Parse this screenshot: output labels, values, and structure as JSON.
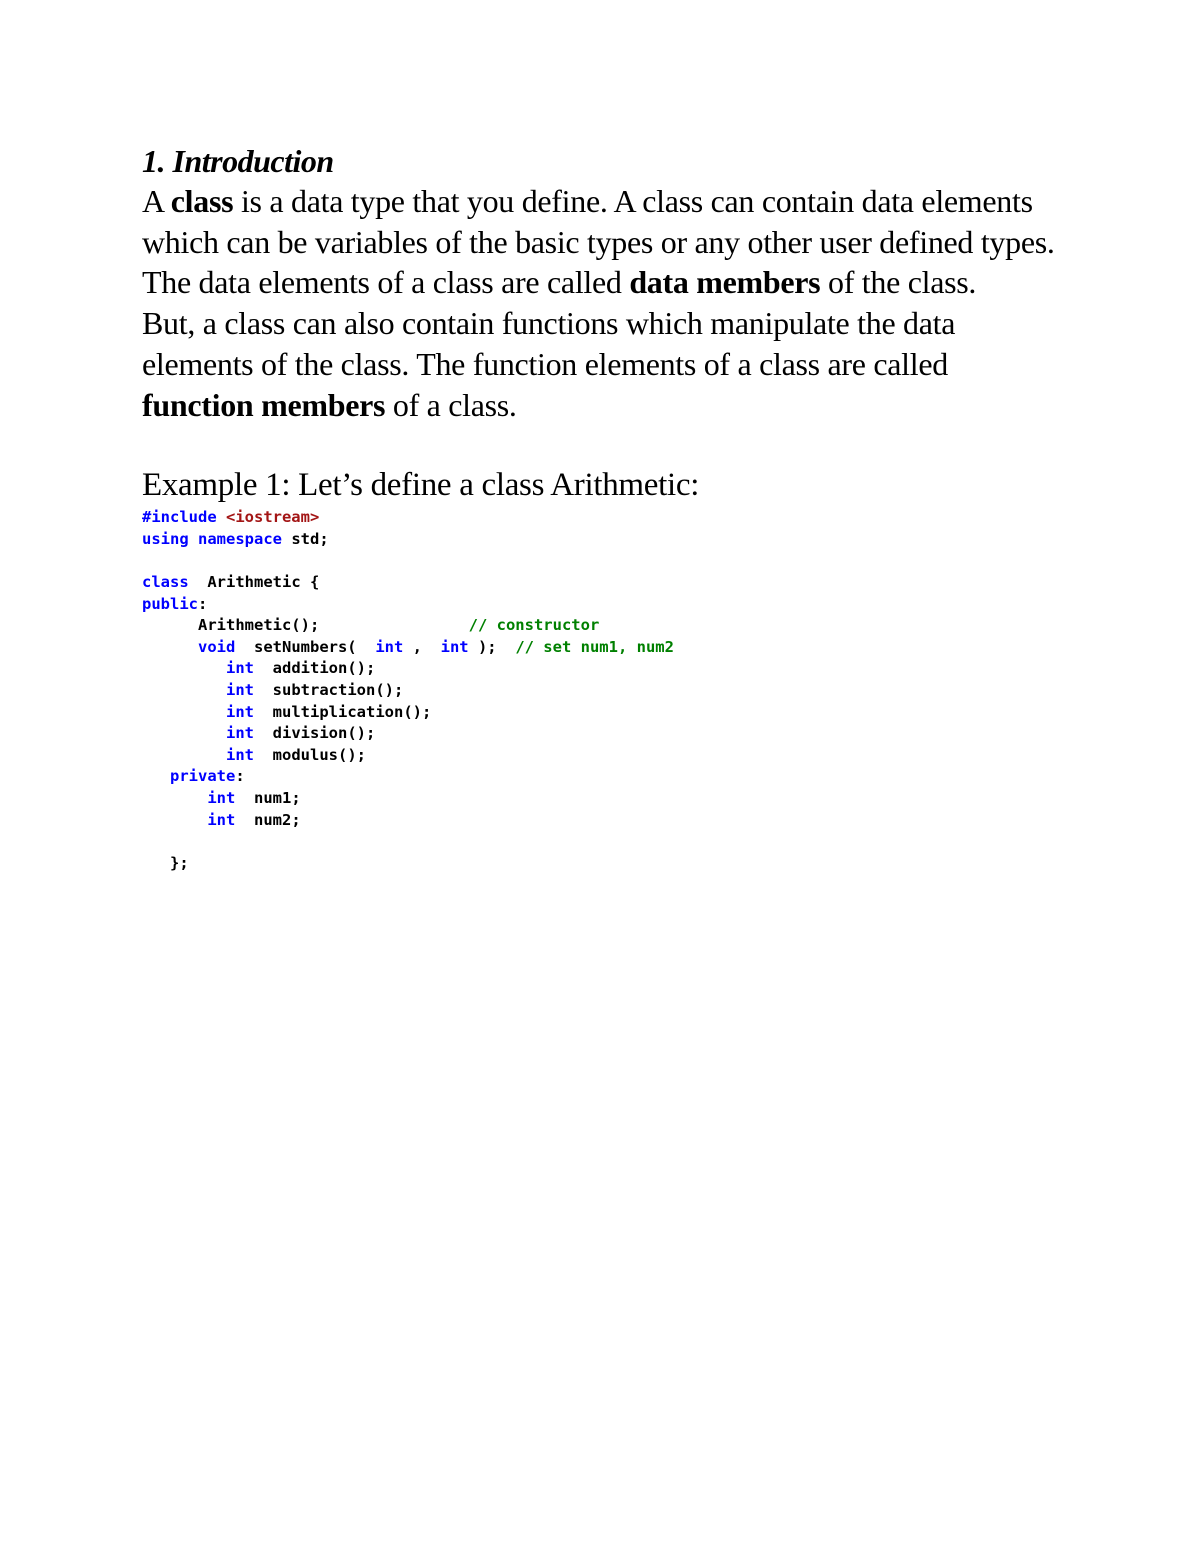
{
  "heading": "1. Introduction",
  "para1": {
    "t1": "A ",
    "b1": "class",
    "t2": " is a data type that you define. A class can contain data elements which can be variables of the basic types or any other user defined types. The data elements of a class are called ",
    "b2": "data members",
    "t3": " of the class."
  },
  "para2": {
    "t1": "But, a class can also contain functions which manipulate the data elements of the class. The function elements of a class are called ",
    "b1": "function members",
    "t2": " of a class."
  },
  "example_title": "Example 1: Let’s define a class Arithmetic:",
  "code": {
    "l1_kw": "#include",
    "l1_inc": " <iostream>",
    "l2_kw1": "using",
    "l2_kw2": "namespace",
    "l2_txt": " std;",
    "l4_kw": "class",
    "l4_txt": "  Arithmetic {",
    "l5_kw": "public",
    "l5_txt": ":",
    "l6_txt": "      Arithmetic();",
    "l6_cm": "// constructor",
    "l7_kw": "void",
    "l7_txt1": "  setNumbers(  ",
    "l7_kw2": "int",
    "l7_txt2": " ,  ",
    "l7_kw3": "int",
    "l7_txt3": " );  ",
    "l7_cm": "// set num1, num2",
    "methods": [
      {
        "type": "int",
        "name": "addition();"
      },
      {
        "type": "int",
        "name": "subtraction();"
      },
      {
        "type": "int",
        "name": "multiplication();"
      },
      {
        "type": "int",
        "name": "division();"
      },
      {
        "type": "int",
        "name": "modulus();"
      }
    ],
    "private_kw": "private",
    "private_txt": ":",
    "fields": [
      {
        "type": "int",
        "name": "num1;"
      },
      {
        "type": "int",
        "name": "num2;"
      }
    ],
    "closing": "};"
  }
}
